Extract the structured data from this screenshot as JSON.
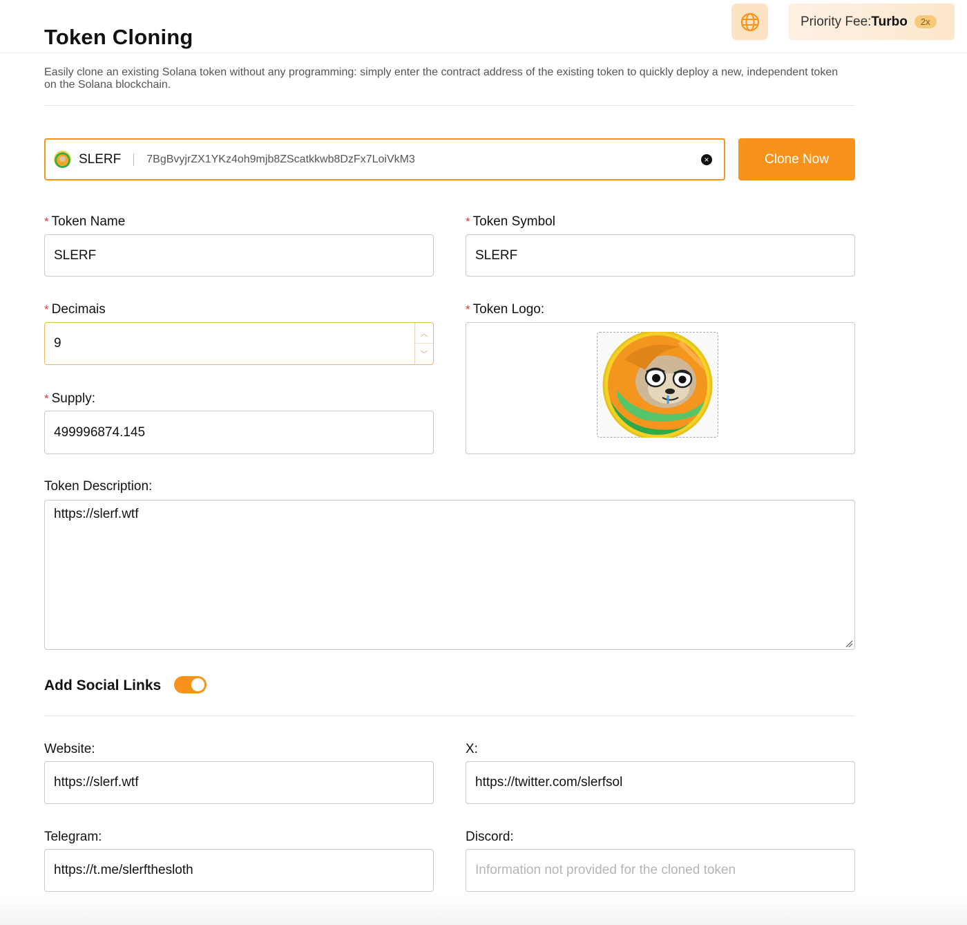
{
  "header": {
    "title": "Token Cloning",
    "language_icon": "globe-icon",
    "priority_fee": {
      "label": "Priority Fee:",
      "value": "Turbo",
      "multiplier": "2x"
    }
  },
  "description": "Easily clone an existing Solana token without any programming: simply enter the contract address of the existing token to quickly deploy a new, independent token on the Solana blockchain.",
  "address_search": {
    "token_icon": "slerf-coin-icon",
    "symbol": "SLERF",
    "address": "7BgBvyjrZX1YKz4oh9mjb8ZScatkkwb8DzFx7LoiVkM3",
    "clear_icon": "clear-icon",
    "button": "Clone Now"
  },
  "form": {
    "required_mark": "*",
    "token_name": {
      "label": "Token Name",
      "value": "SLERF"
    },
    "token_symbol": {
      "label": "Token Symbol",
      "value": "SLERF"
    },
    "decimals": {
      "label": "Decimais",
      "value": "9"
    },
    "token_logo": {
      "label": "Token Logo:"
    },
    "supply": {
      "label": "Supply:",
      "value": "499996874.145"
    },
    "token_description": {
      "label": "Token Description:",
      "value": "https://slerf.wtf"
    }
  },
  "social": {
    "title": "Add Social Links",
    "enabled": true,
    "website": {
      "label": "Website:",
      "value": "https://slerf.wtf"
    },
    "x": {
      "label": "X:",
      "value": "https://twitter.com/slerfsol"
    },
    "telegram": {
      "label": "Telegram:",
      "value": "https://t.me/slerfthesloth"
    },
    "discord": {
      "label": "Discord:",
      "placeholder": "Information not provided for the cloned token"
    }
  },
  "colors": {
    "accent": "#f7931a",
    "required": "#e53935",
    "border": "#c9c9c9"
  }
}
